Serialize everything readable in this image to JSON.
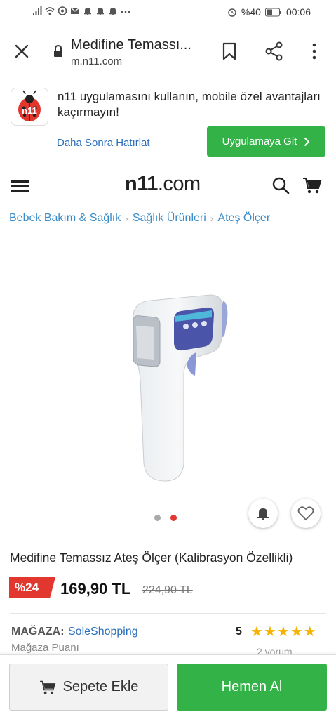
{
  "status_bar": {
    "battery": "%40",
    "time": "00:06",
    "left_icons": [
      "signal-icon",
      "wifi-icon",
      "whatsapp-icon",
      "mail-icon",
      "notification-bell-icon",
      "notification-bell-icon",
      "notification-bell-icon",
      "more-dots-icon"
    ],
    "right_icons": [
      "alarm-icon",
      "mute-icon",
      "battery-icon"
    ]
  },
  "browser": {
    "page_title": "Medifine Temassı...",
    "domain": "m.n11.com",
    "icons": [
      "close-icon",
      "lock-icon",
      "bookmark-icon",
      "share-icon",
      "more-vertical-icon"
    ]
  },
  "app_banner": {
    "message": "n11 uygulamasını kullanın, mobile özel avantajları kaçırmayın!",
    "later_label": "Daha Sonra Hatırlat",
    "goto_label": "Uygulamaya Git",
    "goto_color": "#33b347",
    "logo_text": "n11"
  },
  "site_header": {
    "logo_n11": "n11",
    "logo_com": ".com",
    "icons": [
      "hamburger-icon",
      "search-icon",
      "cart-icon"
    ]
  },
  "breadcrumb": [
    "Bebek Bakım & Sağlık",
    "Sağlık Ürünleri",
    "Ateş Ölçer"
  ],
  "product": {
    "title": "Medifine Temassız Ateş Ölçer (Kalibrasyon Özellikli)",
    "discount": "%24",
    "price": "169,90 TL",
    "old_price": "224,90 TL",
    "image_count": 2,
    "active_image": 2,
    "accent_color": "#e2372f"
  },
  "store": {
    "label": "MAĞAZA:",
    "name": "SoleShopping",
    "score_label": "Mağaza Puanı",
    "rating": "5",
    "stars": 5,
    "reviews": "2 yorum"
  },
  "actions": {
    "add_to_cart": "Sepete Ekle",
    "buy_now": "Hemen Al"
  }
}
